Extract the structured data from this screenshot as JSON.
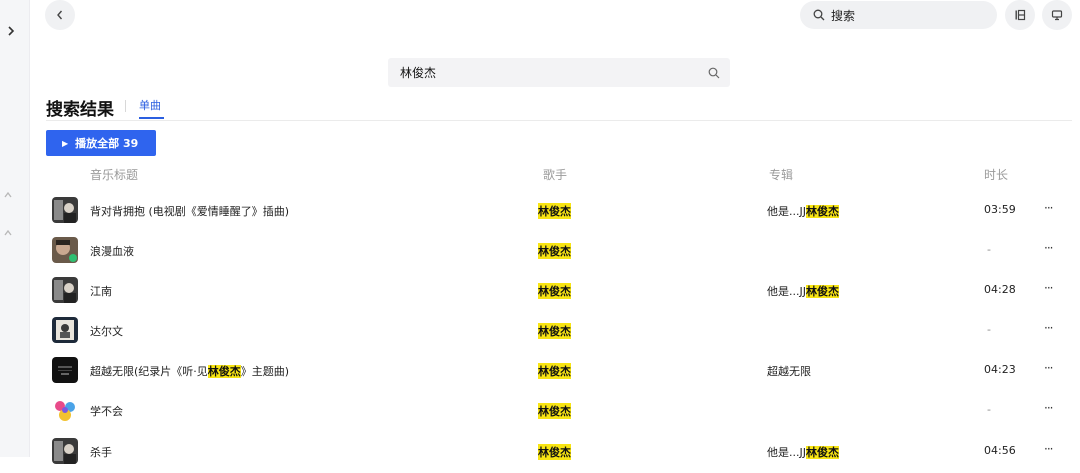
{
  "nav": {
    "back_icon": "chevron-left-icon",
    "expand_icon": "chevron-right-icon",
    "top_search_placeholder": "搜索",
    "top_search_icon": "search-icon",
    "mode_icon": "layout-icon",
    "screen_icon": "monitor-icon"
  },
  "search": {
    "query": "林俊杰"
  },
  "results": {
    "heading": "搜索结果",
    "tab": "单曲",
    "play_all": "播放全部 39"
  },
  "columns": {
    "title": "音乐标题",
    "artist": "歌手",
    "album": "专辑",
    "duration": "时长"
  },
  "songs": [
    {
      "title_pre": "背对背拥抱 (电视剧《爱情睡醒了》插曲)",
      "title_hl": "",
      "title_post": "",
      "artist": "林俊杰",
      "album_pre": "他是...JJ",
      "album_hl": "林俊杰",
      "duration": "03:59"
    },
    {
      "title_pre": "浪漫血液",
      "title_hl": "",
      "title_post": "",
      "artist": "林俊杰",
      "album_pre": "",
      "album_hl": "",
      "duration": "-"
    },
    {
      "title_pre": "江南",
      "title_hl": "",
      "title_post": "",
      "artist": "林俊杰",
      "album_pre": "他是...JJ",
      "album_hl": "林俊杰",
      "duration": "04:28"
    },
    {
      "title_pre": "达尔文",
      "title_hl": "",
      "title_post": "",
      "artist": "林俊杰",
      "album_pre": "",
      "album_hl": "",
      "duration": "-"
    },
    {
      "title_pre": "超越无限(纪录片《听·见",
      "title_hl": "林俊杰",
      "title_post": "》主题曲)",
      "artist": "林俊杰",
      "album_pre": "超越无限",
      "album_hl": "",
      "duration": "04:23"
    },
    {
      "title_pre": "学不会",
      "title_hl": "",
      "title_post": "",
      "artist": "林俊杰",
      "album_pre": "",
      "album_hl": "",
      "duration": "-"
    },
    {
      "title_pre": "杀手",
      "title_hl": "",
      "title_post": "",
      "artist": "林俊杰",
      "album_pre": "他是...JJ",
      "album_hl": "林俊杰",
      "duration": "04:56"
    }
  ],
  "more_label": "···",
  "colors": {
    "accent": "#2f64ee",
    "highlight": "#f8e513"
  }
}
